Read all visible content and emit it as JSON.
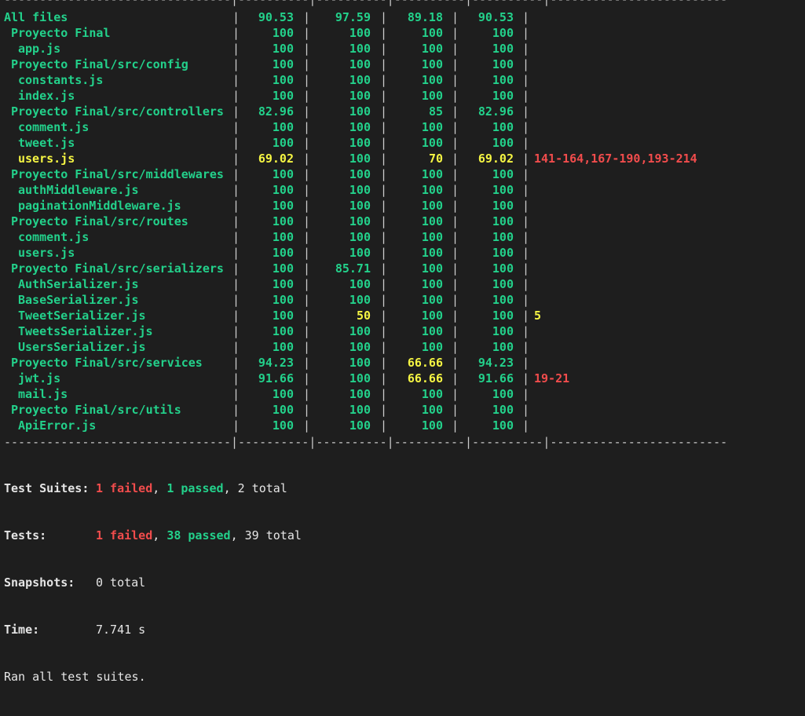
{
  "rows": [
    {
      "name": "All files",
      "stmts": "90.53",
      "branch": "97.59",
      "funcs": "89.18",
      "lines": "90.53",
      "uncovered": "",
      "indent": 0,
      "state": "ok"
    },
    {
      "name": "Proyecto Final",
      "stmts": "100",
      "branch": "100",
      "funcs": "100",
      "lines": "100",
      "uncovered": "",
      "indent": 1,
      "state": "ok"
    },
    {
      "name": "app.js",
      "stmts": "100",
      "branch": "100",
      "funcs": "100",
      "lines": "100",
      "uncovered": "",
      "indent": 2,
      "state": "ok"
    },
    {
      "name": "Proyecto Final/src/config",
      "stmts": "100",
      "branch": "100",
      "funcs": "100",
      "lines": "100",
      "uncovered": "",
      "indent": 1,
      "state": "ok"
    },
    {
      "name": "constants.js",
      "stmts": "100",
      "branch": "100",
      "funcs": "100",
      "lines": "100",
      "uncovered": "",
      "indent": 2,
      "state": "ok"
    },
    {
      "name": "index.js",
      "stmts": "100",
      "branch": "100",
      "funcs": "100",
      "lines": "100",
      "uncovered": "",
      "indent": 2,
      "state": "ok"
    },
    {
      "name": "Proyecto Final/src/controllers",
      "stmts": "82.96",
      "branch": "100",
      "funcs": "85",
      "lines": "82.96",
      "uncovered": "",
      "indent": 1,
      "state": "ok"
    },
    {
      "name": "comment.js",
      "stmts": "100",
      "branch": "100",
      "funcs": "100",
      "lines": "100",
      "uncovered": "",
      "indent": 2,
      "state": "ok"
    },
    {
      "name": "tweet.js",
      "stmts": "100",
      "branch": "100",
      "funcs": "100",
      "lines": "100",
      "uncovered": "",
      "indent": 2,
      "state": "ok"
    },
    {
      "name": "users.js",
      "stmts": "69.02",
      "branch": "100",
      "funcs": "70",
      "lines": "69.02",
      "uncovered": "141-164,167-190,193-214",
      "indent": 2,
      "state": "warn"
    },
    {
      "name": "Proyecto Final/src/middlewares",
      "stmts": "100",
      "branch": "100",
      "funcs": "100",
      "lines": "100",
      "uncovered": "",
      "indent": 1,
      "state": "ok"
    },
    {
      "name": "authMiddleware.js",
      "stmts": "100",
      "branch": "100",
      "funcs": "100",
      "lines": "100",
      "uncovered": "",
      "indent": 2,
      "state": "ok"
    },
    {
      "name": "paginationMiddleware.js",
      "stmts": "100",
      "branch": "100",
      "funcs": "100",
      "lines": "100",
      "uncovered": "",
      "indent": 2,
      "state": "ok"
    },
    {
      "name": "Proyecto Final/src/routes",
      "stmts": "100",
      "branch": "100",
      "funcs": "100",
      "lines": "100",
      "uncovered": "",
      "indent": 1,
      "state": "ok"
    },
    {
      "name": "comment.js",
      "stmts": "100",
      "branch": "100",
      "funcs": "100",
      "lines": "100",
      "uncovered": "",
      "indent": 2,
      "state": "ok"
    },
    {
      "name": "users.js",
      "stmts": "100",
      "branch": "100",
      "funcs": "100",
      "lines": "100",
      "uncovered": "",
      "indent": 2,
      "state": "ok"
    },
    {
      "name": "Proyecto Final/src/serializers",
      "stmts": "100",
      "branch": "85.71",
      "funcs": "100",
      "lines": "100",
      "uncovered": "",
      "indent": 1,
      "state": "ok"
    },
    {
      "name": "AuthSerializer.js",
      "stmts": "100",
      "branch": "100",
      "funcs": "100",
      "lines": "100",
      "uncovered": "",
      "indent": 2,
      "state": "ok"
    },
    {
      "name": "BaseSerializer.js",
      "stmts": "100",
      "branch": "100",
      "funcs": "100",
      "lines": "100",
      "uncovered": "",
      "indent": 2,
      "state": "ok"
    },
    {
      "name": "TweetSerializer.js",
      "stmts": "100",
      "branch": "50",
      "funcs": "100",
      "lines": "100",
      "uncovered": "5",
      "indent": 2,
      "state": "branchwarn"
    },
    {
      "name": "TweetsSerializer.js",
      "stmts": "100",
      "branch": "100",
      "funcs": "100",
      "lines": "100",
      "uncovered": "",
      "indent": 2,
      "state": "ok"
    },
    {
      "name": "UsersSerializer.js",
      "stmts": "100",
      "branch": "100",
      "funcs": "100",
      "lines": "100",
      "uncovered": "",
      "indent": 2,
      "state": "ok"
    },
    {
      "name": "Proyecto Final/src/services",
      "stmts": "94.23",
      "branch": "100",
      "funcs": "66.66",
      "lines": "94.23",
      "uncovered": "",
      "indent": 1,
      "state": "funcwarn"
    },
    {
      "name": "jwt.js",
      "stmts": "91.66",
      "branch": "100",
      "funcs": "66.66",
      "lines": "91.66",
      "uncovered": "19-21",
      "indent": 2,
      "state": "funcwarn"
    },
    {
      "name": "mail.js",
      "stmts": "100",
      "branch": "100",
      "funcs": "100",
      "lines": "100",
      "uncovered": "",
      "indent": 2,
      "state": "ok"
    },
    {
      "name": "Proyecto Final/src/utils",
      "stmts": "100",
      "branch": "100",
      "funcs": "100",
      "lines": "100",
      "uncovered": "",
      "indent": 1,
      "state": "ok"
    },
    {
      "name": "ApiError.js",
      "stmts": "100",
      "branch": "100",
      "funcs": "100",
      "lines": "100",
      "uncovered": "",
      "indent": 2,
      "state": "ok"
    }
  ],
  "summary": {
    "suites_label": "Test Suites:",
    "suites_failed": "1 failed",
    "suites_passed": "1 passed",
    "suites_total": "2 total",
    "tests_label": "Tests:",
    "tests_failed": "1 failed",
    "tests_passed": "38 passed",
    "tests_total": "39 total",
    "snapshots_label": "Snapshots:",
    "snapshots_value": "0 total",
    "time_label": "Time:",
    "time_value": "7.741 s",
    "footer": "Ran all test suites."
  },
  "colors": {
    "background": "#1e1e1e",
    "pass": "#23d18b",
    "warn": "#f5f543",
    "fail": "#f14c4c",
    "text": "#cccccc"
  }
}
